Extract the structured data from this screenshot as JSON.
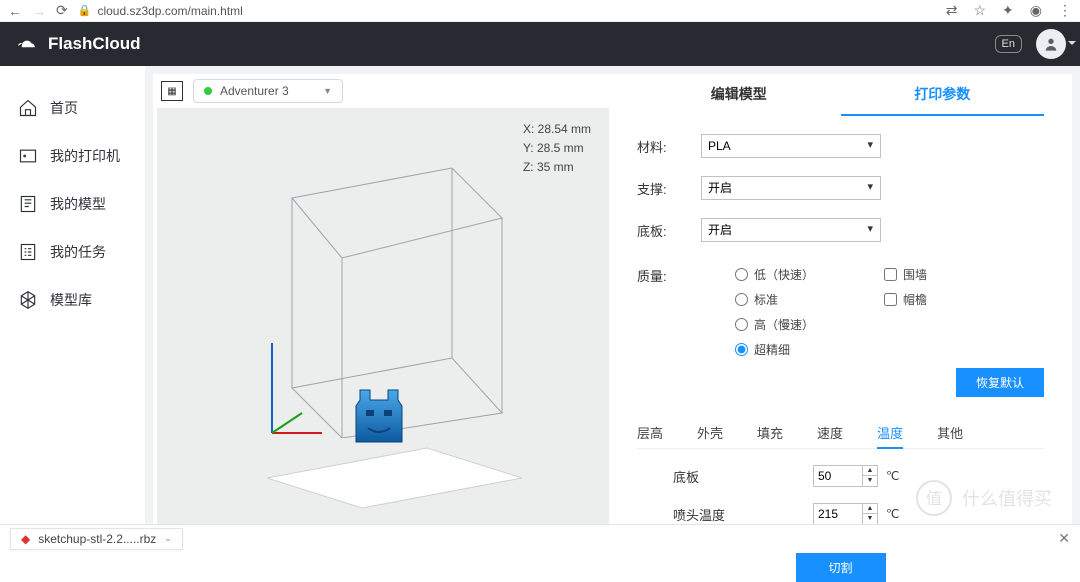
{
  "browser": {
    "url": "cloud.sz3dp.com/main.html"
  },
  "header": {
    "brand": "FlashCloud",
    "lang": "En"
  },
  "sidebar": {
    "items": [
      {
        "label": "首页"
      },
      {
        "label": "我的打印机"
      },
      {
        "label": "我的模型"
      },
      {
        "label": "我的任务"
      },
      {
        "label": "模型库"
      }
    ]
  },
  "toolbar": {
    "printer": "Adventurer 3"
  },
  "dimensions": {
    "x_label": "X:",
    "x_val": "28.54 mm",
    "y_label": "Y:",
    "y_val": "28.5 mm",
    "z_label": "Z:",
    "z_val": "35 mm"
  },
  "tabs": {
    "edit": "编辑模型",
    "params": "打印参数"
  },
  "form": {
    "material_label": "材料:",
    "material_value": "PLA",
    "support_label": "支撑:",
    "support_value": "开启",
    "raft_label": "底板:",
    "raft_value": "开启",
    "quality_label": "质量:",
    "quality_options": {
      "low": "低（快速）",
      "std": "标准",
      "high": "高（慢速）",
      "ultra": "超精细"
    },
    "wall_label": "围墙",
    "brim_label": "帽檐",
    "restore_label": "恢复默认"
  },
  "subtabs": {
    "layer": "层高",
    "shell": "外壳",
    "infill": "填充",
    "speed": "速度",
    "temp": "温度",
    "other": "其他"
  },
  "temp": {
    "raft_label": "底板",
    "raft_value": "50",
    "nozzle_label": "喷头温度",
    "nozzle_value": "215",
    "unit": "℃"
  },
  "slice_btn": "切割",
  "download": {
    "filename": "sketchup-stl-2.2.....rbz"
  },
  "watermark": "什么值得买"
}
